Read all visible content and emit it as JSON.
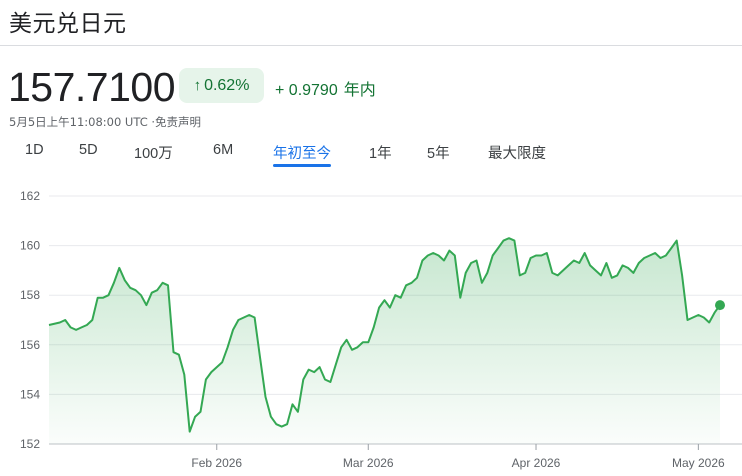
{
  "header": {
    "title": "美元兑日元",
    "price": "157.7100",
    "percent_change": "0.62%",
    "abs_change": "+ 0.9790",
    "period_label": "年内",
    "timestamp": "5月5日上午11:08:00 UTC ·免责声明"
  },
  "tabs": [
    {
      "label": "1D",
      "active": false
    },
    {
      "label": "5D",
      "active": false
    },
    {
      "label": "100万",
      "active": false
    },
    {
      "label": "6M",
      "active": false
    },
    {
      "label": "年初至今",
      "active": true
    },
    {
      "label": "1年",
      "active": false
    },
    {
      "label": "5年",
      "active": false
    },
    {
      "label": "最大限度",
      "active": false
    }
  ],
  "colors": {
    "up": "#137333",
    "line": "#34a853",
    "accent": "#1a73e8"
  },
  "chart_data": {
    "type": "area",
    "ylim": [
      152,
      162
    ],
    "yticks": [
      152,
      154,
      156,
      158,
      160,
      162
    ],
    "xlim": [
      "2026-01-01",
      "2026-05-05"
    ],
    "xticks": [
      {
        "label": "Feb 2026",
        "date": "2026-02-01"
      },
      {
        "label": "Mar 2026",
        "date": "2026-03-01"
      },
      {
        "label": "Apr 2026",
        "date": "2026-04-01"
      },
      {
        "label": "May 2026",
        "date": "2026-05-01"
      }
    ],
    "grid": true,
    "series": [
      {
        "points": [
          [
            "2026-01-01",
            156.8
          ],
          [
            "2026-01-03",
            156.9
          ],
          [
            "2026-01-04",
            157.0
          ],
          [
            "2026-01-05",
            156.7
          ],
          [
            "2026-01-06",
            156.6
          ],
          [
            "2026-01-07",
            156.7
          ],
          [
            "2026-01-08",
            156.8
          ],
          [
            "2026-01-09",
            157.0
          ],
          [
            "2026-01-10",
            157.9
          ],
          [
            "2026-01-11",
            157.9
          ],
          [
            "2026-01-12",
            158.0
          ],
          [
            "2026-01-13",
            158.5
          ],
          [
            "2026-01-14",
            159.1
          ],
          [
            "2026-01-15",
            158.6
          ],
          [
            "2026-01-16",
            158.3
          ],
          [
            "2026-01-17",
            158.2
          ],
          [
            "2026-01-18",
            158.0
          ],
          [
            "2026-01-19",
            157.6
          ],
          [
            "2026-01-20",
            158.1
          ],
          [
            "2026-01-21",
            158.2
          ],
          [
            "2026-01-22",
            158.5
          ],
          [
            "2026-01-23",
            158.4
          ],
          [
            "2026-01-24",
            155.7
          ],
          [
            "2026-01-25",
            155.6
          ],
          [
            "2026-01-26",
            154.8
          ],
          [
            "2026-01-27",
            152.5
          ],
          [
            "2026-01-28",
            153.1
          ],
          [
            "2026-01-29",
            153.3
          ],
          [
            "2026-01-30",
            154.6
          ],
          [
            "2026-01-31",
            154.9
          ],
          [
            "2026-02-01",
            155.1
          ],
          [
            "2026-02-02",
            155.3
          ],
          [
            "2026-02-03",
            155.9
          ],
          [
            "2026-02-04",
            156.6
          ],
          [
            "2026-02-05",
            157.0
          ],
          [
            "2026-02-06",
            157.1
          ],
          [
            "2026-02-07",
            157.2
          ],
          [
            "2026-02-08",
            157.1
          ],
          [
            "2026-02-09",
            155.5
          ],
          [
            "2026-02-10",
            153.9
          ],
          [
            "2026-02-11",
            153.1
          ],
          [
            "2026-02-12",
            152.8
          ],
          [
            "2026-02-13",
            152.7
          ],
          [
            "2026-02-14",
            152.8
          ],
          [
            "2026-02-15",
            153.6
          ],
          [
            "2026-02-16",
            153.3
          ],
          [
            "2026-02-17",
            154.6
          ],
          [
            "2026-02-18",
            155.0
          ],
          [
            "2026-02-19",
            154.9
          ],
          [
            "2026-02-20",
            155.1
          ],
          [
            "2026-02-21",
            154.6
          ],
          [
            "2026-02-22",
            154.5
          ],
          [
            "2026-02-23",
            155.2
          ],
          [
            "2026-02-24",
            155.9
          ],
          [
            "2026-02-25",
            156.2
          ],
          [
            "2026-02-26",
            155.8
          ],
          [
            "2026-02-27",
            155.9
          ],
          [
            "2026-02-28",
            156.1
          ],
          [
            "2026-03-01",
            156.1
          ],
          [
            "2026-03-02",
            156.7
          ],
          [
            "2026-03-03",
            157.5
          ],
          [
            "2026-03-04",
            157.8
          ],
          [
            "2026-03-05",
            157.5
          ],
          [
            "2026-03-06",
            158.0
          ],
          [
            "2026-03-07",
            157.9
          ],
          [
            "2026-03-08",
            158.4
          ],
          [
            "2026-03-09",
            158.5
          ],
          [
            "2026-03-10",
            158.7
          ],
          [
            "2026-03-11",
            159.4
          ],
          [
            "2026-03-12",
            159.6
          ],
          [
            "2026-03-13",
            159.7
          ],
          [
            "2026-03-14",
            159.6
          ],
          [
            "2026-03-15",
            159.4
          ],
          [
            "2026-03-16",
            159.8
          ],
          [
            "2026-03-17",
            159.6
          ],
          [
            "2026-03-18",
            157.9
          ],
          [
            "2026-03-19",
            158.9
          ],
          [
            "2026-03-20",
            159.3
          ],
          [
            "2026-03-21",
            159.4
          ],
          [
            "2026-03-22",
            158.5
          ],
          [
            "2026-03-23",
            158.9
          ],
          [
            "2026-03-24",
            159.6
          ],
          [
            "2026-03-25",
            159.9
          ],
          [
            "2026-03-26",
            160.2
          ],
          [
            "2026-03-27",
            160.3
          ],
          [
            "2026-03-28",
            160.2
          ],
          [
            "2026-03-29",
            158.8
          ],
          [
            "2026-03-30",
            158.9
          ],
          [
            "2026-03-31",
            159.5
          ],
          [
            "2026-04-01",
            159.6
          ],
          [
            "2026-04-02",
            159.6
          ],
          [
            "2026-04-03",
            159.7
          ],
          [
            "2026-04-04",
            158.9
          ],
          [
            "2026-04-05",
            158.8
          ],
          [
            "2026-04-06",
            159.0
          ],
          [
            "2026-04-07",
            159.2
          ],
          [
            "2026-04-08",
            159.4
          ],
          [
            "2026-04-09",
            159.3
          ],
          [
            "2026-04-10",
            159.7
          ],
          [
            "2026-04-11",
            159.2
          ],
          [
            "2026-04-12",
            159.0
          ],
          [
            "2026-04-13",
            158.8
          ],
          [
            "2026-04-14",
            159.3
          ],
          [
            "2026-04-15",
            158.7
          ],
          [
            "2026-04-16",
            158.8
          ],
          [
            "2026-04-17",
            159.2
          ],
          [
            "2026-04-18",
            159.1
          ],
          [
            "2026-04-19",
            158.9
          ],
          [
            "2026-04-20",
            159.3
          ],
          [
            "2026-04-21",
            159.5
          ],
          [
            "2026-04-22",
            159.6
          ],
          [
            "2026-04-23",
            159.7
          ],
          [
            "2026-04-24",
            159.5
          ],
          [
            "2026-04-25",
            159.6
          ],
          [
            "2026-04-26",
            159.9
          ],
          [
            "2026-04-27",
            160.2
          ],
          [
            "2026-04-28",
            158.8
          ],
          [
            "2026-04-29",
            157.0
          ],
          [
            "2026-04-30",
            157.1
          ],
          [
            "2026-05-01",
            157.2
          ],
          [
            "2026-05-02",
            157.1
          ],
          [
            "2026-05-03",
            156.9
          ],
          [
            "2026-05-04",
            157.3
          ],
          [
            "2026-05-05",
            157.6
          ]
        ]
      }
    ]
  }
}
